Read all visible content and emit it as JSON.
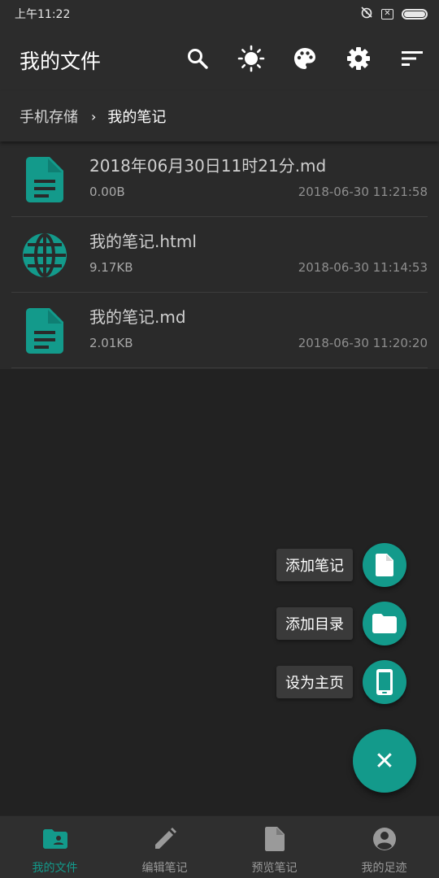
{
  "status_bar": {
    "time": "上午11:22",
    "x_box": "✕"
  },
  "app_bar": {
    "title": "我的文件",
    "actions": [
      {
        "icon": "search-icon"
      },
      {
        "icon": "brightness-icon"
      },
      {
        "icon": "palette-icon"
      },
      {
        "icon": "gear-icon"
      },
      {
        "icon": "sort-icon"
      }
    ]
  },
  "breadcrumb": {
    "root": "手机存储",
    "separator": "›",
    "current": "我的笔记"
  },
  "files": [
    {
      "name": "2018年06月30日11时21分.md",
      "size": "0.00B",
      "date": "2018-06-30 11:21:58",
      "icon": "document-icon"
    },
    {
      "name": "我的笔记.html",
      "size": "9.17KB",
      "date": "2018-06-30 11:14:53",
      "icon": "globe-icon"
    },
    {
      "name": "我的笔记.md",
      "size": "2.01KB",
      "date": "2018-06-30 11:20:20",
      "icon": "document-icon"
    }
  ],
  "fab_menu": {
    "items": [
      {
        "label": "添加笔记",
        "icon": "new-note-icon"
      },
      {
        "label": "添加目录",
        "icon": "folder-icon"
      },
      {
        "label": "设为主页",
        "icon": "phone-icon"
      }
    ],
    "close_symbol": "✕"
  },
  "bottom_nav": {
    "items": [
      {
        "label": "我的文件",
        "icon": "folder-user-icon",
        "active": true
      },
      {
        "label": "编辑笔记",
        "icon": "pencil-icon",
        "active": false
      },
      {
        "label": "预览笔记",
        "icon": "document-icon",
        "active": false
      },
      {
        "label": "我的足迹",
        "icon": "account-icon",
        "active": false
      }
    ]
  },
  "colors": {
    "accent": "#139a8b",
    "background": "#222222",
    "toolbar": "#2c2c2c",
    "list_background": "#2a2a2a"
  }
}
